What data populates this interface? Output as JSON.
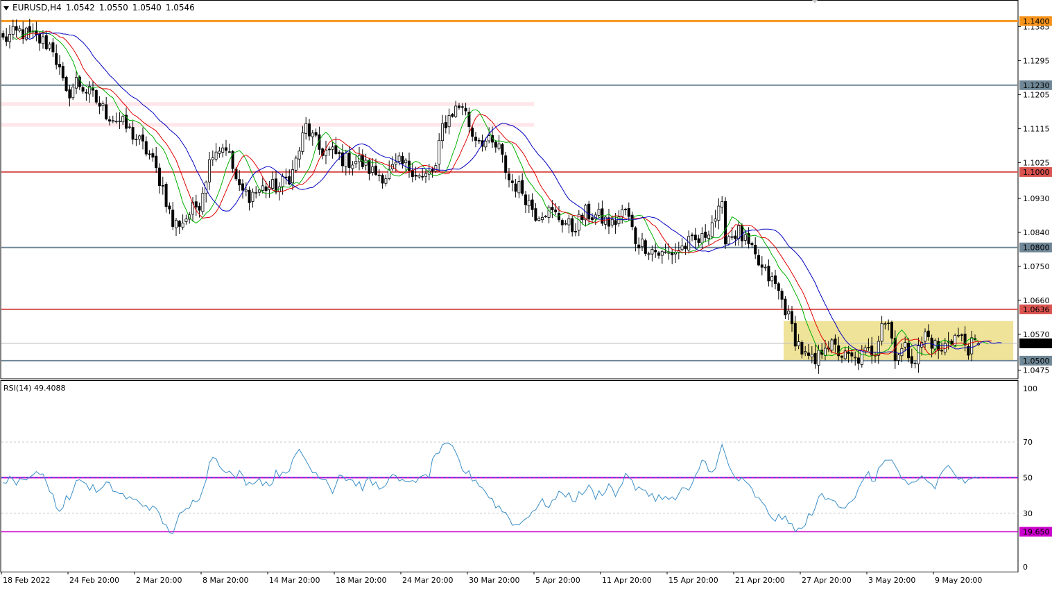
{
  "header": {
    "symbol": "EURUSD,H4",
    "open": "1.0542",
    "high": "1.0550",
    "low": "1.0540",
    "close": "1.0546"
  },
  "rsi_header": {
    "name": "RSI(14)",
    "value": "49.4088"
  },
  "colors": {
    "candle": "#000000",
    "ma_fast": "#00b000",
    "ma_mid": "#e00000",
    "ma_slow": "#0000c0",
    "line_orange": "#f7941d",
    "line_red": "#d9534f",
    "line_gray": "#6f8796",
    "zone_pink": "#ffe6ea",
    "zone_yellow": "#efe39a",
    "rsi_line": "#3c8fc8",
    "rsi_level": "#cc00cc",
    "rsi_fifty": "#3c3cdc"
  },
  "chart_data": [
    {
      "type": "candlestick",
      "series_label": "EURUSD,H4",
      "price_ticks": [
        "1.1385",
        "1.1295",
        "1.1205",
        "1.1115",
        "1.1025",
        "1.0930",
        "1.0840",
        "1.0750",
        "1.0660",
        "1.0570",
        "1.0475"
      ],
      "ylim": [
        1.0452,
        1.143
      ],
      "x_labels": [
        "18 Feb 2022",
        "24 Feb 20:00",
        "2 Mar 20:00",
        "8 Mar 20:00",
        "14 Mar 20:00",
        "18 Mar 20:00",
        "24 Mar 20:00",
        "30 Mar 20:00",
        "5 Apr 20:00",
        "11 Apr 20:00",
        "15 Apr 20:00",
        "21 Apr 20:00",
        "27 Apr 20:00",
        "3 May 20:00",
        "9 May 20:00"
      ],
      "horizontal_levels": [
        {
          "value": 1.14,
          "label": "1.1400",
          "style": "orange"
        },
        {
          "value": 1.123,
          "label": "1.1230",
          "style": "gray"
        },
        {
          "value": 1.1,
          "label": "1.1000",
          "style": "red"
        },
        {
          "value": 1.08,
          "label": "1.0800",
          "style": "gray"
        },
        {
          "value": 1.0636,
          "label": "1.0636",
          "style": "red"
        },
        {
          "value": 1.05,
          "label": "1.0500",
          "style": "gray"
        }
      ],
      "current_price": {
        "value": 1.0546,
        "label": "1.0546"
      },
      "zones": [
        {
          "from_index": 0,
          "to_index": 159,
          "y1": 1.1185,
          "y2": 1.1175,
          "style": "pink"
        },
        {
          "from_index": 0,
          "to_index": 159,
          "y1": 1.113,
          "y2": 1.112,
          "style": "pink"
        },
        {
          "from_index": 235,
          "to_index": 303,
          "y1": 1.0605,
          "y2": 1.05,
          "style": "yellow"
        }
      ],
      "anchors": [
        [
          0,
          1.135
        ],
        [
          5,
          1.1372
        ],
        [
          12,
          1.1345
        ],
        [
          15,
          1.133
        ],
        [
          19,
          1.12
        ],
        [
          22,
          1.124
        ],
        [
          27,
          1.12
        ],
        [
          31,
          1.1155
        ],
        [
          35,
          1.1135
        ],
        [
          40,
          1.109
        ],
        [
          44,
          1.1045
        ],
        [
          48,
          1.096
        ],
        [
          51,
          1.086
        ],
        [
          54,
          1.087
        ],
        [
          59,
          1.092
        ],
        [
          63,
          1.106
        ],
        [
          67,
          1.107
        ],
        [
          71,
          1.095
        ],
        [
          74,
          1.094
        ],
        [
          79,
          1.096
        ],
        [
          83,
          1.096
        ],
        [
          87,
          1.1
        ],
        [
          91,
          1.112
        ],
        [
          95,
          1.106
        ],
        [
          99,
          1.105
        ],
        [
          103,
          1.103
        ],
        [
          107,
          1.103
        ],
        [
          111,
          1.1
        ],
        [
          115,
          1.099
        ],
        [
          119,
          1.102
        ],
        [
          123,
          1.101
        ],
        [
          126,
          1.098
        ],
        [
          130,
          1.101
        ],
        [
          132,
          1.112
        ],
        [
          135,
          1.116
        ],
        [
          138,
          1.118
        ],
        [
          141,
          1.11
        ],
        [
          145,
          1.108
        ],
        [
          149,
          1.106
        ],
        [
          152,
          1.098
        ],
        [
          156,
          1.095
        ],
        [
          160,
          1.089
        ],
        [
          163,
          1.09
        ],
        [
          167,
          1.088
        ],
        [
          171,
          1.085
        ],
        [
          175,
          1.089
        ],
        [
          179,
          1.088
        ],
        [
          183,
          1.086
        ],
        [
          187,
          1.09
        ],
        [
          190,
          1.082
        ],
        [
          194,
          1.08
        ],
        [
          198,
          1.078
        ],
        [
          202,
          1.079
        ],
        [
          206,
          1.081
        ],
        [
          210,
          1.082
        ],
        [
          213,
          1.087
        ],
        [
          216,
          1.09
        ],
        [
          217,
          1.083
        ],
        [
          221,
          1.084
        ],
        [
          224,
          1.08
        ],
        [
          228,
          1.074
        ],
        [
          232,
          1.07
        ],
        [
          235,
          1.064
        ],
        [
          238,
          1.056
        ],
        [
          241,
          1.051
        ],
        [
          244,
          1.049
        ],
        [
          247,
          1.055
        ],
        [
          250,
          1.053
        ],
        [
          253,
          1.051
        ],
        [
          256,
          1.05
        ],
        [
          259,
          1.052
        ],
        [
          262,
          1.053
        ],
        [
          264,
          1.061
        ],
        [
          266,
          1.06
        ],
        [
          268,
          1.052
        ],
        [
          271,
          1.053
        ],
        [
          274,
          1.0505
        ],
        [
          277,
          1.057
        ],
        [
          280,
          1.054
        ],
        [
          282,
          1.052
        ],
        [
          284,
          1.056
        ],
        [
          287,
          1.0565
        ],
        [
          290,
          1.0535
        ],
        [
          293,
          1.0546
        ]
      ],
      "moving_averages": [
        {
          "period": 5,
          "style": "ma_fast"
        },
        {
          "period": 8,
          "style": "ma_mid"
        },
        {
          "period": 13,
          "style": "ma_slow"
        }
      ]
    },
    {
      "type": "line",
      "series_label": "RSI(14)",
      "ylim": [
        0,
        100
      ],
      "y_ticks": [
        100,
        70,
        50,
        30,
        0
      ],
      "levels": [
        {
          "value": 50,
          "label": "",
          "style": "fifty"
        },
        {
          "value": 19.65,
          "label": "19.650",
          "style": "level"
        }
      ],
      "anchors": [
        [
          0,
          45
        ],
        [
          2,
          52
        ],
        [
          4,
          46
        ],
        [
          6,
          51
        ],
        [
          8,
          50
        ],
        [
          11,
          54
        ],
        [
          13,
          46
        ],
        [
          15,
          40
        ],
        [
          17,
          31
        ],
        [
          19,
          38
        ],
        [
          21,
          42
        ],
        [
          23,
          50
        ],
        [
          25,
          46
        ],
        [
          27,
          44
        ],
        [
          29,
          42
        ],
        [
          31,
          46
        ],
        [
          33,
          44
        ],
        [
          35,
          41
        ],
        [
          38,
          38
        ],
        [
          41,
          36
        ],
        [
          44,
          34
        ],
        [
          47,
          29
        ],
        [
          49,
          22
        ],
        [
          51,
          20
        ],
        [
          53,
          28
        ],
        [
          55,
          31
        ],
        [
          57,
          36
        ],
        [
          59,
          40
        ],
        [
          61,
          51
        ],
        [
          63,
          63
        ],
        [
          65,
          58
        ],
        [
          67,
          55
        ],
        [
          69,
          50
        ],
        [
          71,
          52
        ],
        [
          74,
          46
        ],
        [
          76,
          50
        ],
        [
          78,
          48
        ],
        [
          80,
          46
        ],
        [
          82,
          52
        ],
        [
          85,
          54
        ],
        [
          87,
          58
        ],
        [
          89,
          65
        ],
        [
          91,
          60
        ],
        [
          93,
          53
        ],
        [
          95,
          52
        ],
        [
          97,
          49
        ],
        [
          99,
          43
        ],
        [
          101,
          52
        ],
        [
          104,
          49
        ],
        [
          106,
          47
        ],
        [
          108,
          45
        ],
        [
          110,
          48
        ],
        [
          112,
          46
        ],
        [
          114,
          43
        ],
        [
          116,
          52
        ],
        [
          118,
          49
        ],
        [
          121,
          46
        ],
        [
          123,
          50
        ],
        [
          125,
          48
        ],
        [
          128,
          52
        ],
        [
          130,
          64
        ],
        [
          132,
          66
        ],
        [
          134,
          68
        ],
        [
          136,
          63
        ],
        [
          138,
          55
        ],
        [
          141,
          50
        ],
        [
          143,
          47
        ],
        [
          145,
          42
        ],
        [
          148,
          35
        ],
        [
          151,
          30
        ],
        [
          154,
          23
        ],
        [
          156,
          25
        ],
        [
          158,
          30
        ],
        [
          160,
          33
        ],
        [
          162,
          36
        ],
        [
          164,
          35
        ],
        [
          166,
          38
        ],
        [
          168,
          42
        ],
        [
          170,
          40
        ],
        [
          172,
          38
        ],
        [
          174,
          42
        ],
        [
          176,
          44
        ],
        [
          178,
          40
        ],
        [
          180,
          42
        ],
        [
          182,
          46
        ],
        [
          184,
          40
        ],
        [
          186,
          48
        ],
        [
          188,
          52
        ],
        [
          190,
          42
        ],
        [
          192,
          44
        ],
        [
          194,
          42
        ],
        [
          196,
          38
        ],
        [
          198,
          40
        ],
        [
          200,
          37
        ],
        [
          202,
          38
        ],
        [
          204,
          44
        ],
        [
          206,
          41
        ],
        [
          208,
          50
        ],
        [
          210,
          60
        ],
        [
          212,
          56
        ],
        [
          214,
          54
        ],
        [
          216,
          68
        ],
        [
          218,
          56
        ],
        [
          220,
          50
        ],
        [
          222,
          48
        ],
        [
          224,
          45
        ],
        [
          226,
          40
        ],
        [
          228,
          35
        ],
        [
          230,
          30
        ],
        [
          232,
          27
        ],
        [
          234,
          28
        ],
        [
          236,
          24
        ],
        [
          238,
          22
        ],
        [
          240,
          20
        ],
        [
          242,
          28
        ],
        [
          244,
          34
        ],
        [
          246,
          40
        ],
        [
          248,
          37
        ],
        [
          250,
          38
        ],
        [
          252,
          34
        ],
        [
          254,
          36
        ],
        [
          256,
          40
        ],
        [
          258,
          46
        ],
        [
          260,
          52
        ],
        [
          262,
          48
        ],
        [
          264,
          58
        ],
        [
          266,
          62
        ],
        [
          268,
          56
        ],
        [
          270,
          50
        ],
        [
          272,
          44
        ],
        [
          274,
          46
        ],
        [
          276,
          50
        ],
        [
          278,
          48
        ],
        [
          280,
          44
        ],
        [
          282,
          54
        ],
        [
          284,
          56
        ],
        [
          286,
          52
        ],
        [
          288,
          48
        ],
        [
          290,
          47
        ],
        [
          292,
          49
        ],
        [
          293,
          49.4
        ]
      ]
    }
  ]
}
